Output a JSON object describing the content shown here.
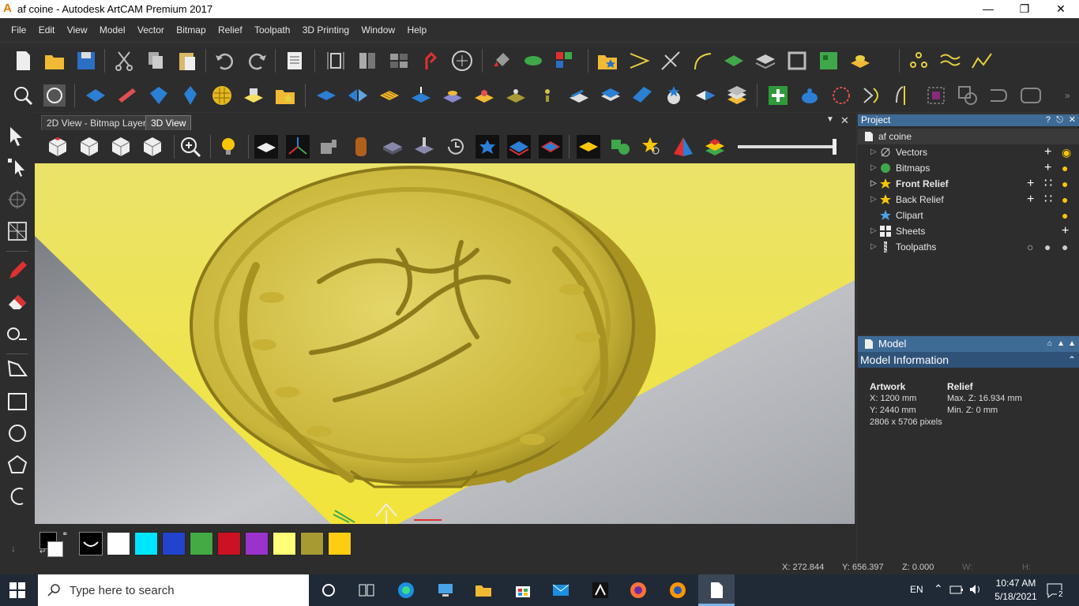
{
  "window": {
    "title": "af coine - Autodesk ArtCAM Premium 2017",
    "controls": [
      "minimize",
      "restore",
      "close"
    ]
  },
  "menu": [
    "File",
    "Edit",
    "View",
    "Model",
    "Vector",
    "Bitmap",
    "Relief",
    "Toolpath",
    "3D Printing",
    "Window",
    "Help"
  ],
  "tabs": [
    {
      "label": "2D View - Bitmap Layer",
      "active": false
    },
    {
      "label": "3D View",
      "active": true
    }
  ],
  "project": {
    "header": "Project",
    "header_controls": [
      "?",
      "pin",
      "close"
    ],
    "root": "af coine",
    "items": [
      {
        "label": "Vectors",
        "bold": false,
        "icon": "vector-icon"
      },
      {
        "label": "Bitmaps",
        "bold": false,
        "icon": "bitmap-icon"
      },
      {
        "label": "Front Relief",
        "bold": true,
        "icon": "star-icon"
      },
      {
        "label": "Back Relief",
        "bold": false,
        "icon": "star-icon"
      },
      {
        "label": "Clipart",
        "bold": false,
        "icon": "clipart-star-icon"
      },
      {
        "label": "Sheets",
        "bold": false,
        "icon": "sheets-icon"
      },
      {
        "label": "Toolpaths",
        "bold": false,
        "icon": "toolpath-icon"
      }
    ]
  },
  "model": {
    "header": "Model",
    "info_header": "Model Information",
    "artwork_label": "Artwork",
    "relief_label": "Relief",
    "x": "X: 1200 mm",
    "y": "Y: 2440 mm",
    "pixels": "2806 x 5706 pixels",
    "max_z": "Max. Z: 16.934 mm",
    "min_z": "Min. Z: 0 mm"
  },
  "status": {
    "x": "X: 272.844",
    "y": "Y: 656.397",
    "z": "Z: 0.000",
    "w": "W:",
    "h": "H:"
  },
  "palette": [
    "#ffffff",
    "#00e5ff",
    "#2244cc",
    "#44aa44",
    "#cc1122",
    "#9933cc",
    "#ffff77",
    "#a89a33",
    "#ffcc11"
  ],
  "colors": {
    "accent": "#3e6a96",
    "relief_gold": "#d8c34a",
    "ground_yellow": "#f0e040"
  },
  "taskbar": {
    "search_placeholder": "Type here to search",
    "language": "EN",
    "time": "10:47 AM",
    "date": "5/18/2021",
    "notification_count": "2"
  }
}
